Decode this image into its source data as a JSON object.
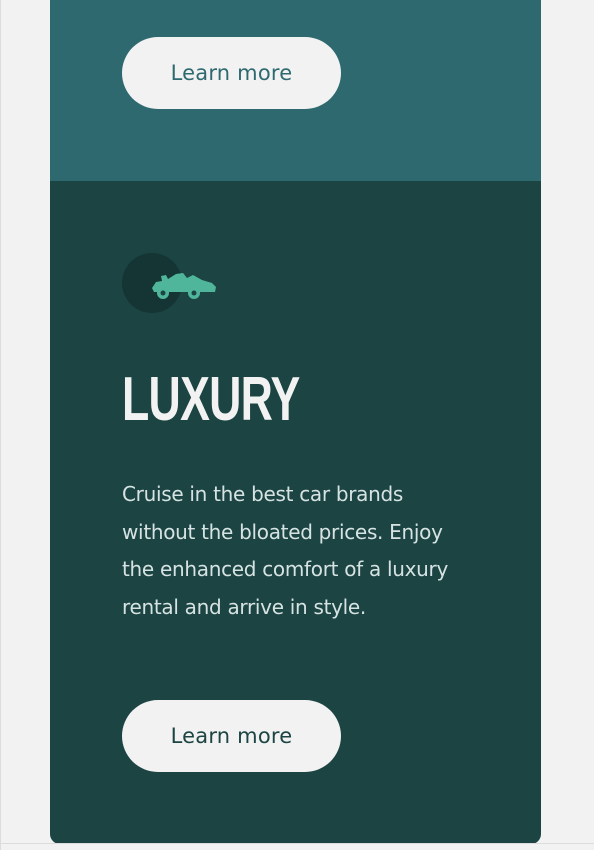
{
  "colors": {
    "page_background": "#f2f2f2",
    "top_card_background": "#2e6970",
    "luxury_card_background": "#1b4443",
    "button_background": "#f2f2f2",
    "top_button_text": "#2e6970",
    "luxury_button_text": "#1b4443",
    "icon_accent": "#4fb69b",
    "icon_circle": "#143533",
    "title_color": "#f2f2f2",
    "body_text_color": "#d6e3e2"
  },
  "top_card": {
    "button_label": "Learn more"
  },
  "luxury_card": {
    "icon": "luxury-car-icon",
    "title": "LUXURY",
    "description": "Cruise in the best car brands without the bloated prices. Enjoy the enhanced comfort of a luxury rental and arrive in style.",
    "button_label": "Learn more"
  }
}
